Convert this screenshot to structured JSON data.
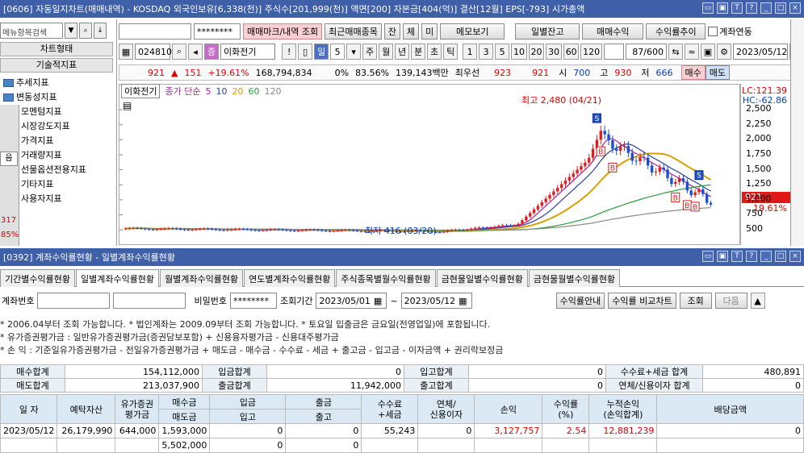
{
  "top_window": {
    "title": "[0606] 자동일지차트(매매내역) - KOSDAQ 외국인보유[6,338(천)] 주식수[201,999(천)] 액면[200] 자본금[404(억)] 결산[12월] EPS[-793] 시가총액",
    "buttons": [
      "▭",
      "▣",
      "T",
      "?",
      "_",
      "□",
      "×"
    ]
  },
  "sidebar": {
    "search_placeholder": "메뉴항목검색",
    "section1": "차트형태",
    "section2": "기술적지표",
    "items": [
      "추세지표",
      "변동성지표",
      "모멘텀지표",
      "시장강도지표",
      "가격지표",
      "거래량지표",
      "선물옵션전용지표",
      "기타지표",
      "사용자지표"
    ],
    "overlay_values": [
      "음",
      "317",
      "85%"
    ]
  },
  "toolbar1": {
    "account_masked": "********",
    "mark_button": "매매마크/내역 조회",
    "recent_button": "최근매매종목",
    "small_buttons": [
      "잔",
      "체",
      "미"
    ],
    "memo_button": "메모보기",
    "daily_balance": "일별잔고",
    "buy_profit": "매매수익",
    "profit_trend": "수익률추이",
    "account_link_label": "계좌연동"
  },
  "toolbar2": {
    "code": "024810",
    "stock_name": "이화전기",
    "period_selected": "일",
    "period_count": "5",
    "periods": [
      "주",
      "월",
      "년",
      "분",
      "초",
      "틱"
    ],
    "intervals": [
      "1",
      "3",
      "5",
      "10",
      "20",
      "30",
      "60",
      "120"
    ],
    "page_counter": "87/600",
    "date": "2023/05/12"
  },
  "quote": {
    "price": "921",
    "change_arrow": "▲",
    "change": "151",
    "change_pct": "+19.61%",
    "volume": "168,794,834",
    "zero_pct": "0%",
    "ratio": "83.56%",
    "amount": "139,143백만",
    "best_price_label": "최우선",
    "best1": "923",
    "best2": "921",
    "open_label": "시",
    "open": "700",
    "high_label": "고",
    "high": "930",
    "low_label": "저",
    "low": "666",
    "buy_btn": "매수",
    "sell_btn": "매도"
  },
  "chart_legend": {
    "name": "이화전기",
    "ma_label": "종가 단순",
    "ma_periods": [
      "5",
      "10",
      "20",
      "60",
      "120"
    ],
    "ma_colors": [
      "#b0209a",
      "#2a3f9f",
      "#d8a000",
      "#2b9d3a",
      "#8a8a8a"
    ]
  },
  "chart_annotations": {
    "high": "최고 2,480 (04/21)",
    "low": "최저 416 (03/20)",
    "lc": "LC:121.39",
    "hc": "HC:-62.86",
    "current_price_tag": "921",
    "current_pct_tag": "19.61%"
  },
  "chart_data": {
    "type": "candlestick",
    "y_ticks": [
      "2,500",
      "2,250",
      "2,000",
      "1,750",
      "1,500",
      "1,250",
      "1,000",
      "750",
      "500"
    ],
    "ylim": [
      300,
      2650
    ],
    "marks": [
      "S",
      "B",
      "B",
      "S",
      "B",
      "B",
      "B"
    ]
  },
  "bottom_window": {
    "title": "[0392] 계좌수익률현황 - 일별계좌수익률현황",
    "tabs": [
      "기간별수익률현황",
      "일별계좌수익률현황",
      "월별계좌수익률현황",
      "연도별계좌수익률현황",
      "주식종목별월수익률현황",
      "금현물일별수익률현황",
      "금현물월별수익률현황"
    ],
    "acct_label": "계좌번호",
    "pw_label": "비밀번호",
    "pw_masked": "********",
    "period_label": "조회기간",
    "date_from": "2023/05/01",
    "tilde": "~",
    "date_to": "2023/05/12",
    "guide_btn": "수익률안내",
    "compare_btn": "수익률 비교차트",
    "query_btn": "조회",
    "next_btn": "다음",
    "notes": [
      "* 2006.04부터 조회 가능합니다.   * 법인계좌는 2009.09부터 조회 가능합니다.   * 토요일 입출금은 금요일(전영업일)에 포함됩니다.",
      "* 유가증권평가금 : 일반유가증권평가금(증권담보포함) + 신용융자평가금 - 신용대주평가금",
      "* 손         익 : 기준일유가증권평가금 - 전일유가증권평가금 + 매도금 - 매수금 - 수수료 - 세금 + 출고금 - 입고금 - 이자금액 + 권리락보정금"
    ],
    "summary": [
      [
        "매수합계",
        "154,112,000",
        "입금합계",
        "0",
        "입고합계",
        "0",
        "수수료+세금 합계",
        "480,891"
      ],
      [
        "매도합계",
        "213,037,900",
        "출금합계",
        "11,942,000",
        "출고합계",
        "0",
        "연체/신용이자 합계",
        "0"
      ]
    ],
    "grid_headers": [
      "일 자",
      "예탁자산",
      "유가증권\n평가금",
      "매수금",
      "입금",
      "출금",
      "수수료\n+세금",
      "연체/\n신용이자",
      "손익",
      "수익률\n(%)",
      "누적손익\n(손익합계)",
      "배당금액"
    ],
    "grid_headers2": [
      "매도금",
      "입고",
      "출고"
    ],
    "rows": [
      [
        "2023/05/12",
        "26,179,990",
        "644,000",
        "1,593,000",
        "0",
        "0",
        "55,243",
        "0",
        "3,127,757",
        "2.54",
        "12,881,239",
        "0"
      ],
      [
        "",
        "",
        "",
        "5,502,000",
        "0",
        "0",
        "",
        "",
        "",
        "",
        "",
        ""
      ]
    ]
  }
}
